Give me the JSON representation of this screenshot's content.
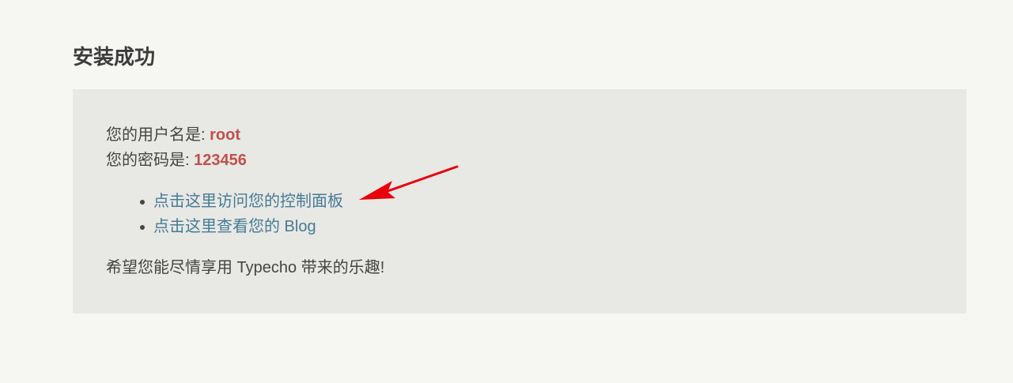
{
  "page": {
    "title": "安装成功"
  },
  "credentials": {
    "username_label": "您的用户名是: ",
    "username_value": "root",
    "password_label": "您的密码是: ",
    "password_value": "123456"
  },
  "links": {
    "dashboard": "点击这里访问您的控制面板",
    "blog": "点击这里查看您的 Blog"
  },
  "footer": {
    "message": "希望您能尽情享用 Typecho 带来的乐趣!"
  },
  "annotation": {
    "arrow_icon": "red-arrow-icon",
    "arrow_color": "#e8000b"
  },
  "colors": {
    "background": "#f6f6f3",
    "panel": "#e8e8e4",
    "link": "#467b96",
    "highlight": "#c0504d"
  }
}
